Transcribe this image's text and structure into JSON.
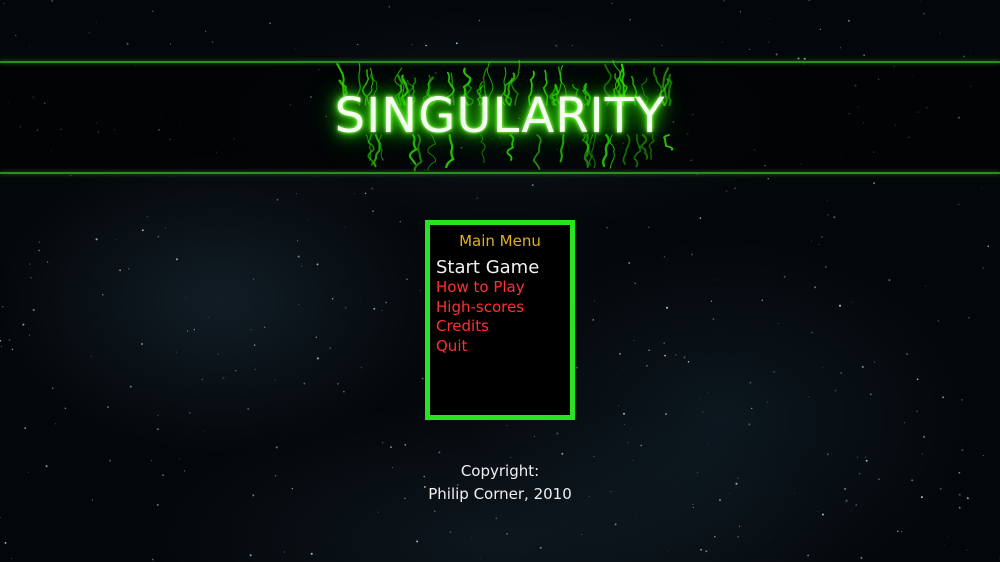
{
  "game": {
    "title": "SINGULARITY"
  },
  "menu": {
    "heading": "Main Menu",
    "items": [
      {
        "label": "Start Game",
        "selected": true
      },
      {
        "label": "How to Play",
        "selected": false
      },
      {
        "label": "High-scores",
        "selected": false
      },
      {
        "label": "Credits",
        "selected": false
      },
      {
        "label": "Quit",
        "selected": false
      }
    ]
  },
  "footer": {
    "copyright_label": "Copyright:",
    "copyright_owner": "Philip Corner, 2010"
  },
  "colors": {
    "menu_border": "#25e61e",
    "menu_heading": "#e0b020",
    "menu_item": "#ff3030",
    "menu_item_selected": "#f2f2f2",
    "title_glow": "#2ee000",
    "band_line": "#2f8a22"
  }
}
